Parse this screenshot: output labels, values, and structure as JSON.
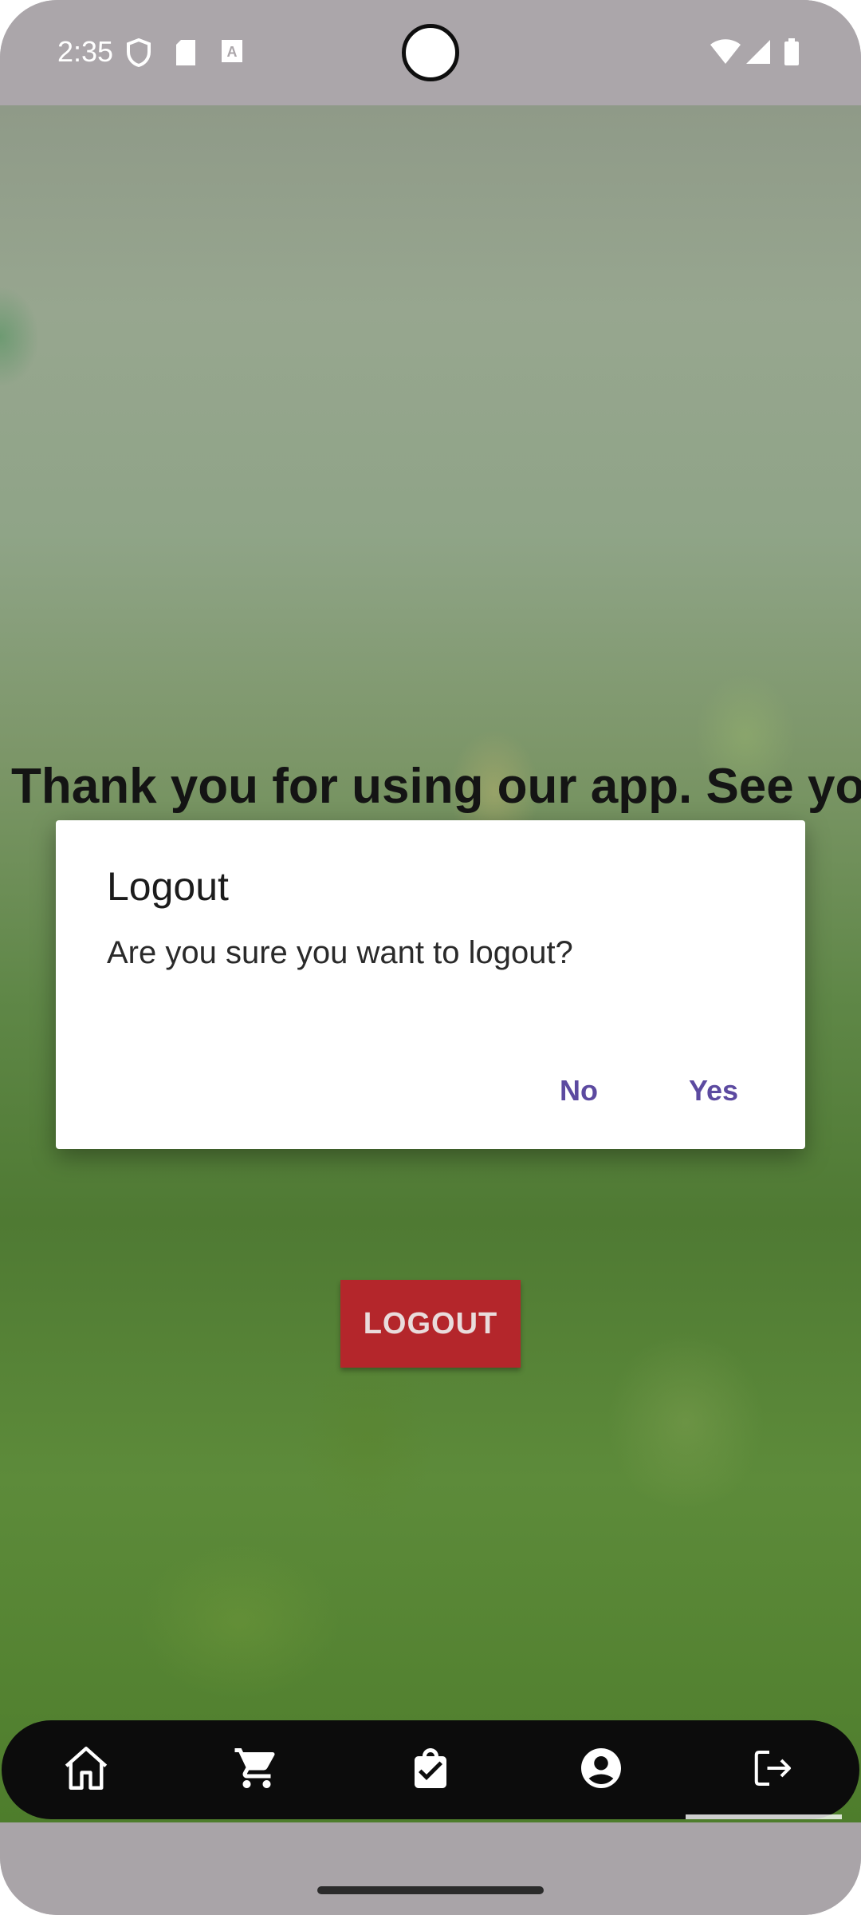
{
  "status_bar": {
    "time": "2:35",
    "icons": [
      "shield-icon",
      "sd-card-icon",
      "font-a-icon",
      "wifi-icon",
      "signal-icon",
      "battery-icon"
    ]
  },
  "main": {
    "message": "Thank you for using our app. See you",
    "logout_label": "LOGOUT",
    "logout_color": "#b4262b"
  },
  "dialog": {
    "title": "Logout",
    "message": "Are you sure you want to logout?",
    "no_label": "No",
    "yes_label": "Yes",
    "accent": "#5c4aa0"
  },
  "bottom_nav": {
    "items": [
      {
        "icon": "home-icon"
      },
      {
        "icon": "cart-icon"
      },
      {
        "icon": "shopping-bag-check-icon"
      },
      {
        "icon": "account-icon"
      },
      {
        "icon": "logout-icon",
        "selected": true
      }
    ]
  }
}
